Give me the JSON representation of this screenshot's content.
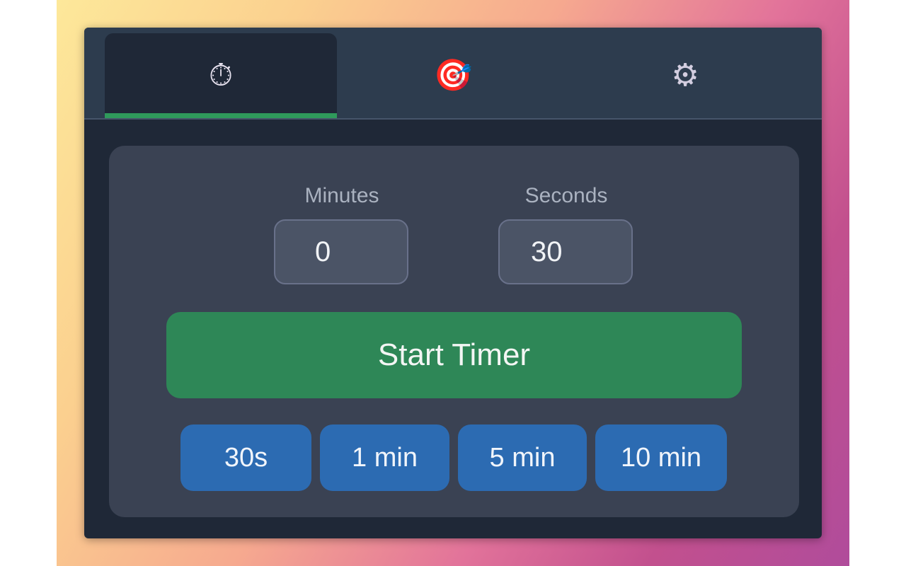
{
  "tabs": [
    {
      "icon": "stopwatch-icon",
      "glyph": "⏱",
      "active": true
    },
    {
      "icon": "target-icon",
      "glyph": "🎯",
      "active": false
    },
    {
      "icon": "gear-icon",
      "glyph": "⚙",
      "active": false
    }
  ],
  "timer": {
    "minutes_label": "Minutes",
    "minutes_value": "0",
    "seconds_label": "Seconds",
    "seconds_value": "30",
    "start_label": "Start Timer"
  },
  "presets": [
    {
      "label": "30s"
    },
    {
      "label": "1 min"
    },
    {
      "label": "5 min"
    },
    {
      "label": "10 min"
    }
  ],
  "colors": {
    "panel_bg": "#1f2837",
    "tabbar_bg": "#2d3c4e",
    "card_bg": "#3a4253",
    "accent_green": "#2e8757",
    "preset_blue": "#2c6bb2"
  }
}
